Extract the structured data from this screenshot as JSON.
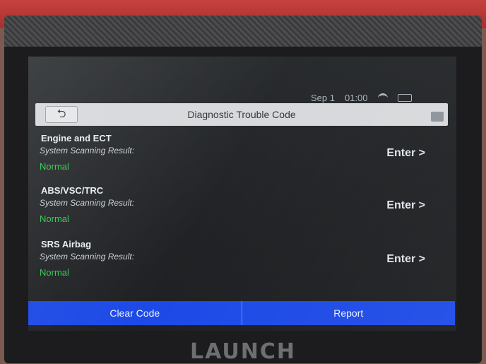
{
  "status_bar": {
    "date": "Sep 1",
    "time": "01:00",
    "wifi_icon": "wifi-icon",
    "battery_icon": "battery-icon"
  },
  "header": {
    "back_icon": "back-arrow-icon",
    "title": "Diagnostic Trouble Code",
    "camera_icon": "camera-icon"
  },
  "systems": [
    {
      "name": "Engine and ECT",
      "scan_label": "System Scanning Result:",
      "result": "Normal",
      "enter_label": "Enter >"
    },
    {
      "name": "ABS/VSC/TRC",
      "scan_label": "System Scanning Result:",
      "result": "Normal",
      "enter_label": "Enter >"
    },
    {
      "name": "SRS Airbag",
      "scan_label": "System Scanning Result:",
      "result": "Normal",
      "enter_label": "Enter >"
    }
  ],
  "bottom_bar": {
    "clear_label": "Clear Code",
    "report_label": "Report"
  },
  "device": {
    "brand": "LAUNCH"
  },
  "colors": {
    "accent": "#1846e6",
    "status_ok": "#2ec84a",
    "header_bg": "#d6d8db"
  }
}
